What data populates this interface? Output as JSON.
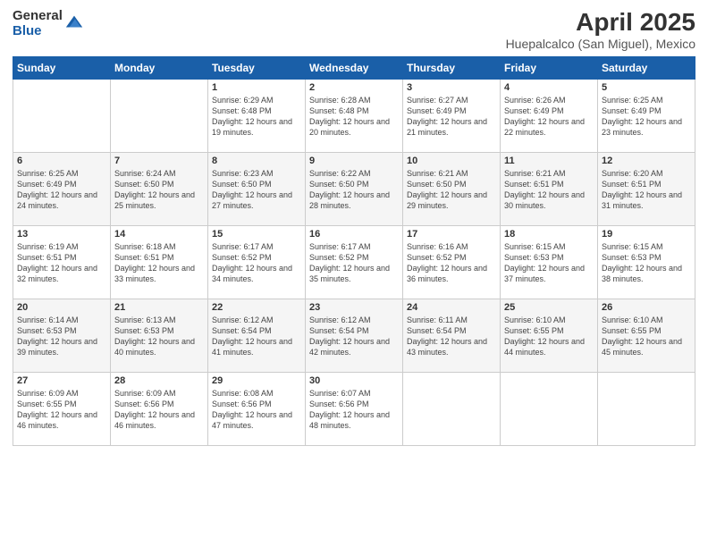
{
  "logo": {
    "general": "General",
    "blue": "Blue"
  },
  "title": "April 2025",
  "location": "Huepalcalco (San Miguel), Mexico",
  "weekdays": [
    "Sunday",
    "Monday",
    "Tuesday",
    "Wednesday",
    "Thursday",
    "Friday",
    "Saturday"
  ],
  "weeks": [
    [
      {
        "day": "",
        "sunrise": "",
        "sunset": "",
        "daylight": ""
      },
      {
        "day": "",
        "sunrise": "",
        "sunset": "",
        "daylight": ""
      },
      {
        "day": "1",
        "sunrise": "Sunrise: 6:29 AM",
        "sunset": "Sunset: 6:48 PM",
        "daylight": "Daylight: 12 hours and 19 minutes."
      },
      {
        "day": "2",
        "sunrise": "Sunrise: 6:28 AM",
        "sunset": "Sunset: 6:48 PM",
        "daylight": "Daylight: 12 hours and 20 minutes."
      },
      {
        "day": "3",
        "sunrise": "Sunrise: 6:27 AM",
        "sunset": "Sunset: 6:49 PM",
        "daylight": "Daylight: 12 hours and 21 minutes."
      },
      {
        "day": "4",
        "sunrise": "Sunrise: 6:26 AM",
        "sunset": "Sunset: 6:49 PM",
        "daylight": "Daylight: 12 hours and 22 minutes."
      },
      {
        "day": "5",
        "sunrise": "Sunrise: 6:25 AM",
        "sunset": "Sunset: 6:49 PM",
        "daylight": "Daylight: 12 hours and 23 minutes."
      }
    ],
    [
      {
        "day": "6",
        "sunrise": "Sunrise: 6:25 AM",
        "sunset": "Sunset: 6:49 PM",
        "daylight": "Daylight: 12 hours and 24 minutes."
      },
      {
        "day": "7",
        "sunrise": "Sunrise: 6:24 AM",
        "sunset": "Sunset: 6:50 PM",
        "daylight": "Daylight: 12 hours and 25 minutes."
      },
      {
        "day": "8",
        "sunrise": "Sunrise: 6:23 AM",
        "sunset": "Sunset: 6:50 PM",
        "daylight": "Daylight: 12 hours and 27 minutes."
      },
      {
        "day": "9",
        "sunrise": "Sunrise: 6:22 AM",
        "sunset": "Sunset: 6:50 PM",
        "daylight": "Daylight: 12 hours and 28 minutes."
      },
      {
        "day": "10",
        "sunrise": "Sunrise: 6:21 AM",
        "sunset": "Sunset: 6:50 PM",
        "daylight": "Daylight: 12 hours and 29 minutes."
      },
      {
        "day": "11",
        "sunrise": "Sunrise: 6:21 AM",
        "sunset": "Sunset: 6:51 PM",
        "daylight": "Daylight: 12 hours and 30 minutes."
      },
      {
        "day": "12",
        "sunrise": "Sunrise: 6:20 AM",
        "sunset": "Sunset: 6:51 PM",
        "daylight": "Daylight: 12 hours and 31 minutes."
      }
    ],
    [
      {
        "day": "13",
        "sunrise": "Sunrise: 6:19 AM",
        "sunset": "Sunset: 6:51 PM",
        "daylight": "Daylight: 12 hours and 32 minutes."
      },
      {
        "day": "14",
        "sunrise": "Sunrise: 6:18 AM",
        "sunset": "Sunset: 6:51 PM",
        "daylight": "Daylight: 12 hours and 33 minutes."
      },
      {
        "day": "15",
        "sunrise": "Sunrise: 6:17 AM",
        "sunset": "Sunset: 6:52 PM",
        "daylight": "Daylight: 12 hours and 34 minutes."
      },
      {
        "day": "16",
        "sunrise": "Sunrise: 6:17 AM",
        "sunset": "Sunset: 6:52 PM",
        "daylight": "Daylight: 12 hours and 35 minutes."
      },
      {
        "day": "17",
        "sunrise": "Sunrise: 6:16 AM",
        "sunset": "Sunset: 6:52 PM",
        "daylight": "Daylight: 12 hours and 36 minutes."
      },
      {
        "day": "18",
        "sunrise": "Sunrise: 6:15 AM",
        "sunset": "Sunset: 6:53 PM",
        "daylight": "Daylight: 12 hours and 37 minutes."
      },
      {
        "day": "19",
        "sunrise": "Sunrise: 6:15 AM",
        "sunset": "Sunset: 6:53 PM",
        "daylight": "Daylight: 12 hours and 38 minutes."
      }
    ],
    [
      {
        "day": "20",
        "sunrise": "Sunrise: 6:14 AM",
        "sunset": "Sunset: 6:53 PM",
        "daylight": "Daylight: 12 hours and 39 minutes."
      },
      {
        "day": "21",
        "sunrise": "Sunrise: 6:13 AM",
        "sunset": "Sunset: 6:53 PM",
        "daylight": "Daylight: 12 hours and 40 minutes."
      },
      {
        "day": "22",
        "sunrise": "Sunrise: 6:12 AM",
        "sunset": "Sunset: 6:54 PM",
        "daylight": "Daylight: 12 hours and 41 minutes."
      },
      {
        "day": "23",
        "sunrise": "Sunrise: 6:12 AM",
        "sunset": "Sunset: 6:54 PM",
        "daylight": "Daylight: 12 hours and 42 minutes."
      },
      {
        "day": "24",
        "sunrise": "Sunrise: 6:11 AM",
        "sunset": "Sunset: 6:54 PM",
        "daylight": "Daylight: 12 hours and 43 minutes."
      },
      {
        "day": "25",
        "sunrise": "Sunrise: 6:10 AM",
        "sunset": "Sunset: 6:55 PM",
        "daylight": "Daylight: 12 hours and 44 minutes."
      },
      {
        "day": "26",
        "sunrise": "Sunrise: 6:10 AM",
        "sunset": "Sunset: 6:55 PM",
        "daylight": "Daylight: 12 hours and 45 minutes."
      }
    ],
    [
      {
        "day": "27",
        "sunrise": "Sunrise: 6:09 AM",
        "sunset": "Sunset: 6:55 PM",
        "daylight": "Daylight: 12 hours and 46 minutes."
      },
      {
        "day": "28",
        "sunrise": "Sunrise: 6:09 AM",
        "sunset": "Sunset: 6:56 PM",
        "daylight": "Daylight: 12 hours and 46 minutes."
      },
      {
        "day": "29",
        "sunrise": "Sunrise: 6:08 AM",
        "sunset": "Sunset: 6:56 PM",
        "daylight": "Daylight: 12 hours and 47 minutes."
      },
      {
        "day": "30",
        "sunrise": "Sunrise: 6:07 AM",
        "sunset": "Sunset: 6:56 PM",
        "daylight": "Daylight: 12 hours and 48 minutes."
      },
      {
        "day": "",
        "sunrise": "",
        "sunset": "",
        "daylight": ""
      },
      {
        "day": "",
        "sunrise": "",
        "sunset": "",
        "daylight": ""
      },
      {
        "day": "",
        "sunrise": "",
        "sunset": "",
        "daylight": ""
      }
    ]
  ]
}
